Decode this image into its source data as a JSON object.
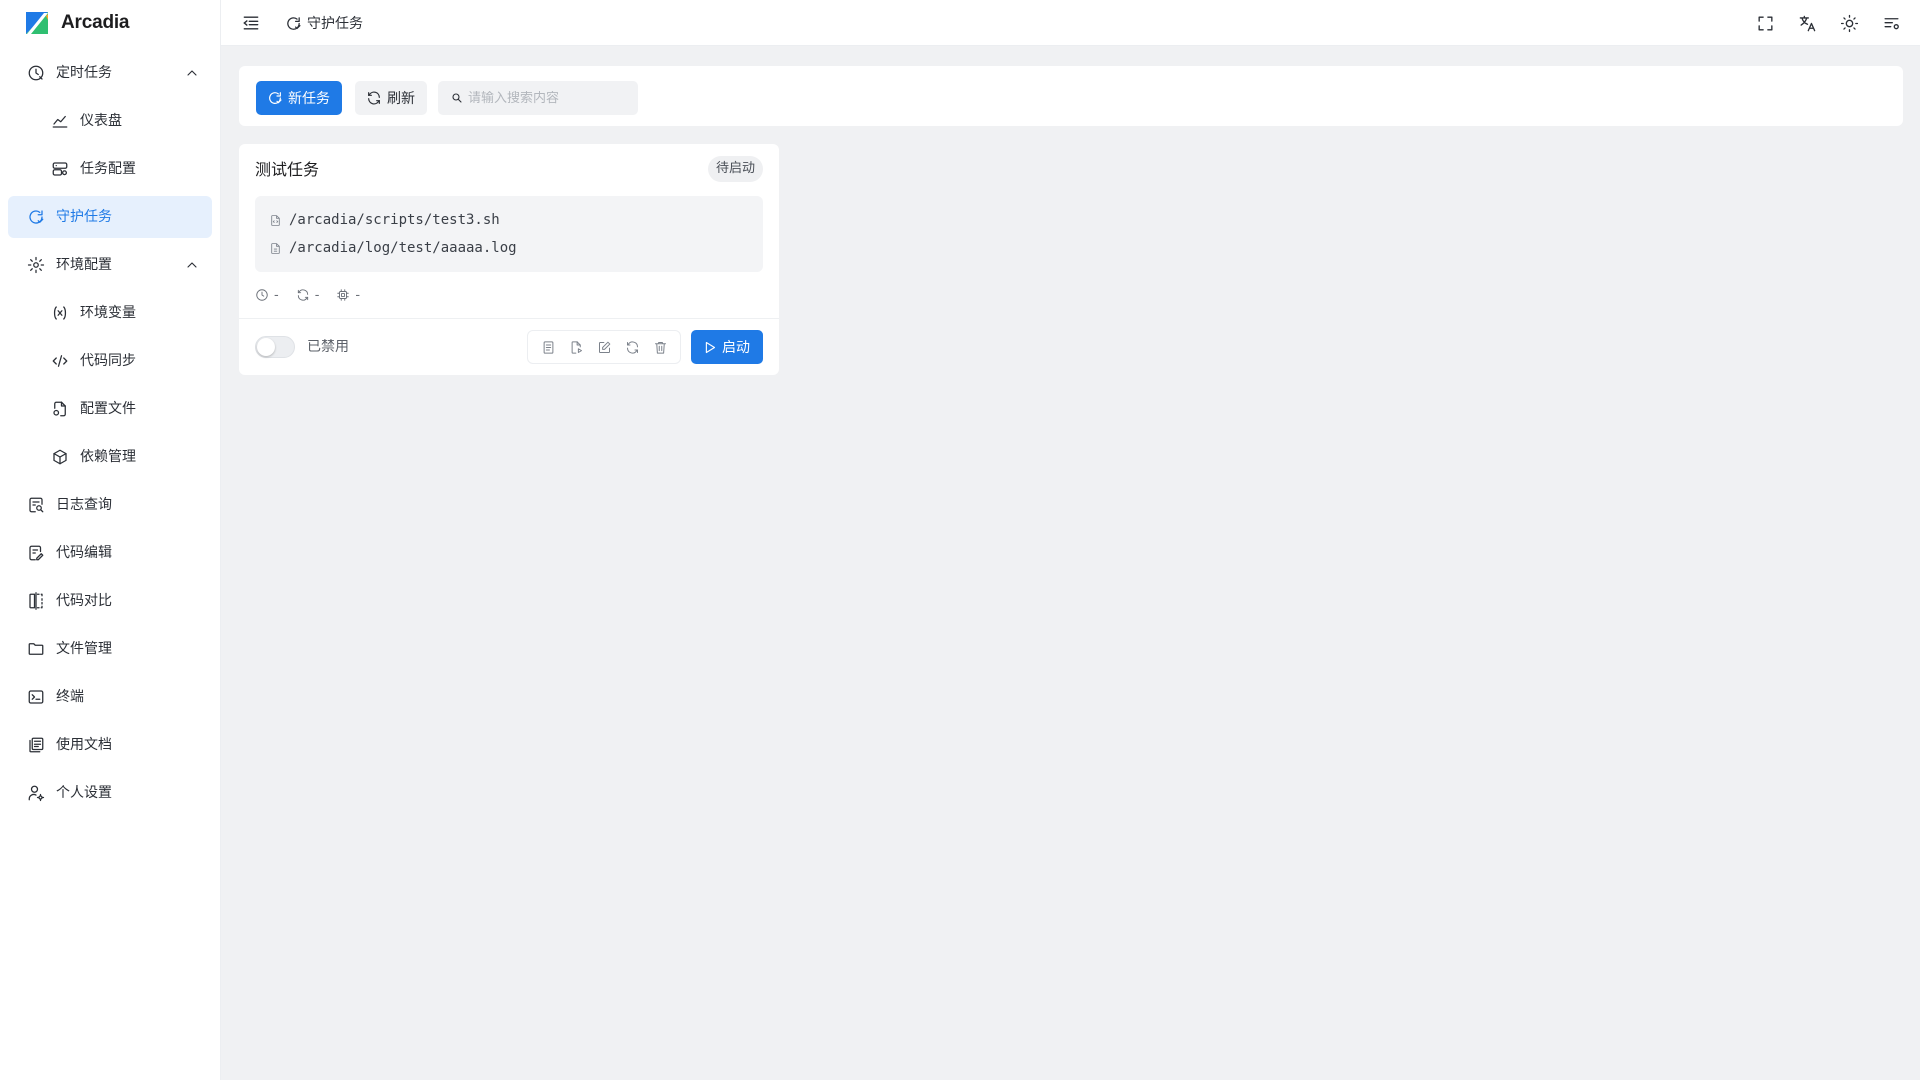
{
  "app": {
    "name": "Arcadia",
    "brand_color": "#1f7ae6"
  },
  "sidebar": {
    "items": [
      {
        "label": "定时任务",
        "icon": "clock-schedule-icon",
        "expanded": true
      },
      {
        "label": "仪表盘",
        "icon": "chart-line-icon"
      },
      {
        "label": "任务配置",
        "icon": "server-config-icon"
      },
      {
        "label": "守护任务",
        "icon": "daemon-refresh-icon",
        "active": true
      },
      {
        "label": "环境配置",
        "icon": "gear-icon",
        "expanded": true
      },
      {
        "label": "环境变量",
        "icon": "variable-icon"
      },
      {
        "label": "代码同步",
        "icon": "code-sync-icon"
      },
      {
        "label": "配置文件",
        "icon": "file-config-icon"
      },
      {
        "label": "依赖管理",
        "icon": "package-icon"
      },
      {
        "label": "日志查询",
        "icon": "log-search-icon"
      },
      {
        "label": "代码编辑",
        "icon": "code-edit-icon"
      },
      {
        "label": "代码对比",
        "icon": "diff-icon"
      },
      {
        "label": "文件管理",
        "icon": "folder-icon"
      },
      {
        "label": "终端",
        "icon": "terminal-icon"
      },
      {
        "label": "使用文档",
        "icon": "docs-icon"
      },
      {
        "label": "个人设置",
        "icon": "user-settings-icon"
      }
    ]
  },
  "header": {
    "breadcrumb": "守护任务",
    "icons": [
      "fullscreen-icon",
      "translate-icon",
      "theme-sun-icon",
      "layout-settings-icon"
    ]
  },
  "toolbar": {
    "new_task_label": "新任务",
    "refresh_label": "刷新",
    "search_placeholder": "请输入搜索内容",
    "search_value": ""
  },
  "task": {
    "title": "测试任务",
    "status": "待启动",
    "script_path": "/arcadia/scripts/test3.sh",
    "log_path": "/arcadia/log/test/aaaaa.log",
    "meta": {
      "time": "-",
      "restarts": "-",
      "cpu": "-"
    },
    "enabled": false,
    "toggle_label": "已禁用",
    "start_label": "启动",
    "actions": [
      "log-icon",
      "file-run-icon",
      "edit-icon",
      "refresh-icon",
      "trash-icon"
    ]
  }
}
